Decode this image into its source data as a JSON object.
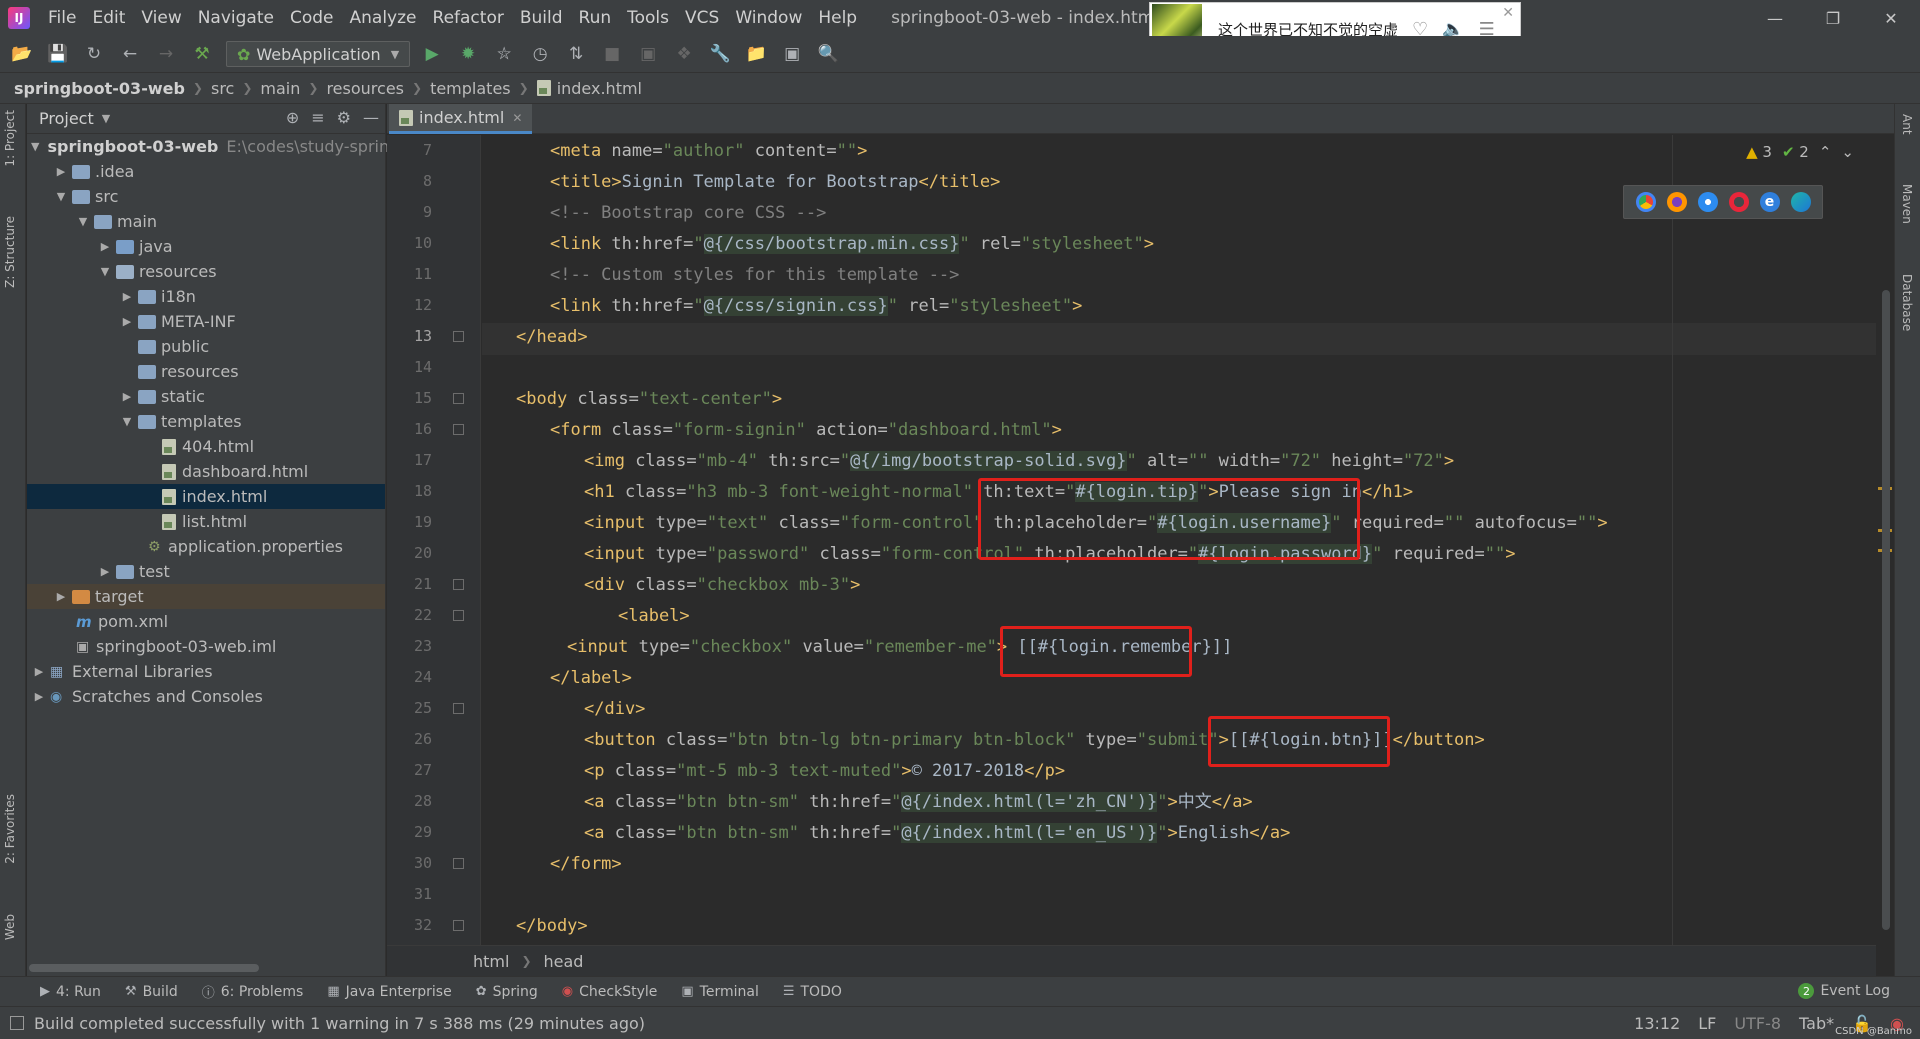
{
  "window": {
    "title": "springboot-03-web - index.html",
    "menu": [
      "File",
      "Edit",
      "View",
      "Navigate",
      "Code",
      "Analyze",
      "Refactor",
      "Build",
      "Run",
      "Tools",
      "VCS",
      "Window",
      "Help"
    ]
  },
  "music_popup": {
    "song_title": "这个世界已不知不觉的空虚"
  },
  "toolbar": {
    "run_config": "WebApplication"
  },
  "breadcrumb": [
    "springboot-03-web",
    "src",
    "main",
    "resources",
    "templates",
    "index.html"
  ],
  "left_stripe": {
    "project_tab": "1: Project",
    "structure_tab": "Z: Structure",
    "favorites_tab": "2: Favorites",
    "web_tab": "Web"
  },
  "right_stripe": {
    "ant_tab": "Ant",
    "maven_tab": "Maven",
    "database_tab": "Database"
  },
  "project_panel": {
    "title": "Project",
    "tree": [
      {
        "label": "springboot-03-web",
        "hint": "E:\\codes\\study-sprin",
        "bold": true
      },
      {
        "label": ".idea"
      },
      {
        "label": "src"
      },
      {
        "label": "main"
      },
      {
        "label": "java"
      },
      {
        "label": "resources"
      },
      {
        "label": "i18n"
      },
      {
        "label": "META-INF"
      },
      {
        "label": "public"
      },
      {
        "label": "resources"
      },
      {
        "label": "static"
      },
      {
        "label": "templates"
      },
      {
        "label": "404.html"
      },
      {
        "label": "dashboard.html"
      },
      {
        "label": "index.html"
      },
      {
        "label": "list.html"
      },
      {
        "label": "application.properties"
      },
      {
        "label": "test"
      },
      {
        "label": "target"
      },
      {
        "label": "pom.xml"
      },
      {
        "label": "springboot-03-web.iml"
      },
      {
        "label": "External Libraries"
      },
      {
        "label": "Scratches and Consoles"
      }
    ]
  },
  "editor": {
    "tab_label": "index.html",
    "inspection": {
      "warnings": "3",
      "ok": "2"
    },
    "current_line": 13,
    "line_numbers": [
      "7",
      "8",
      "9",
      "10",
      "11",
      "12",
      "13",
      "14",
      "15",
      "16",
      "17",
      "18",
      "19",
      "20",
      "21",
      "22",
      "23",
      "24",
      "25",
      "26",
      "27",
      "28",
      "29",
      "30",
      "31",
      "32"
    ],
    "footer_crumbs": [
      "html",
      "head"
    ]
  },
  "bottom_tools": {
    "run": "4: Run",
    "build": "Build",
    "problems": "6: Problems",
    "java_enterprise": "Java Enterprise",
    "spring": "Spring",
    "checkstyle": "CheckStyle",
    "terminal": "Terminal",
    "todo": "TODO",
    "event_log": "Event Log",
    "event_count": "2"
  },
  "status": {
    "message": "Build completed successfully with 1 warning in 7 s 388 ms (29 minutes ago)",
    "position": "13:12",
    "line_sep": "LF",
    "encoding": "UTF-8",
    "indent": "Tab*",
    "watermark": "CSDN @Banmo"
  }
}
